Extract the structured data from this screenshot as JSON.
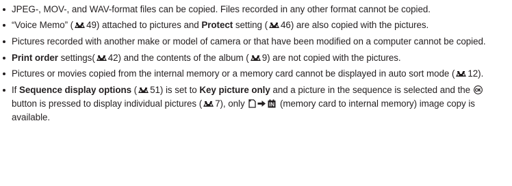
{
  "notes": [
    {
      "t1": "JPEG-, MOV-, and WAV-format files can be copied. Files recorded in any other format cannot be copied."
    },
    {
      "t1": "“Voice Memo” (",
      "r1": "49",
      "t2": ") attached to pictures and ",
      "b1": "Protect",
      "t3": " setting (",
      "r2": "46",
      "t4": ") are also copied with the pictures."
    },
    {
      "t1": "Pictures recorded with another make or model of camera or that have been modified on a computer cannot be copied."
    },
    {
      "b1": "Print order",
      "t1": " settings(",
      "r1": "42",
      "t2": ") and the contents of the album (",
      "r2": "9",
      "t3": ") are not copied with the pictures."
    },
    {
      "t1": "Pictures or movies copied from the internal memory or a memory card cannot be displayed in auto sort mode (",
      "r1": "12",
      "t2": ")."
    },
    {
      "t1": "If ",
      "b1": "Sequence display options",
      "t2": " (",
      "r1": "51",
      "t3": ") is set to ",
      "b2": "Key picture only",
      "t4": " and a picture in the sequence is selected and the ",
      "t5": " button is pressed to display individual pictures (",
      "r2": "7",
      "t6": "), only ",
      "t7": " (memory card to internal memory) image copy is available."
    }
  ],
  "icons": {
    "xref": "reference-page-icon",
    "ok": "ok-button-icon",
    "memory": "internal-memory-icon",
    "arrow": "arrow-right-icon",
    "card": "memory-card-icon"
  }
}
